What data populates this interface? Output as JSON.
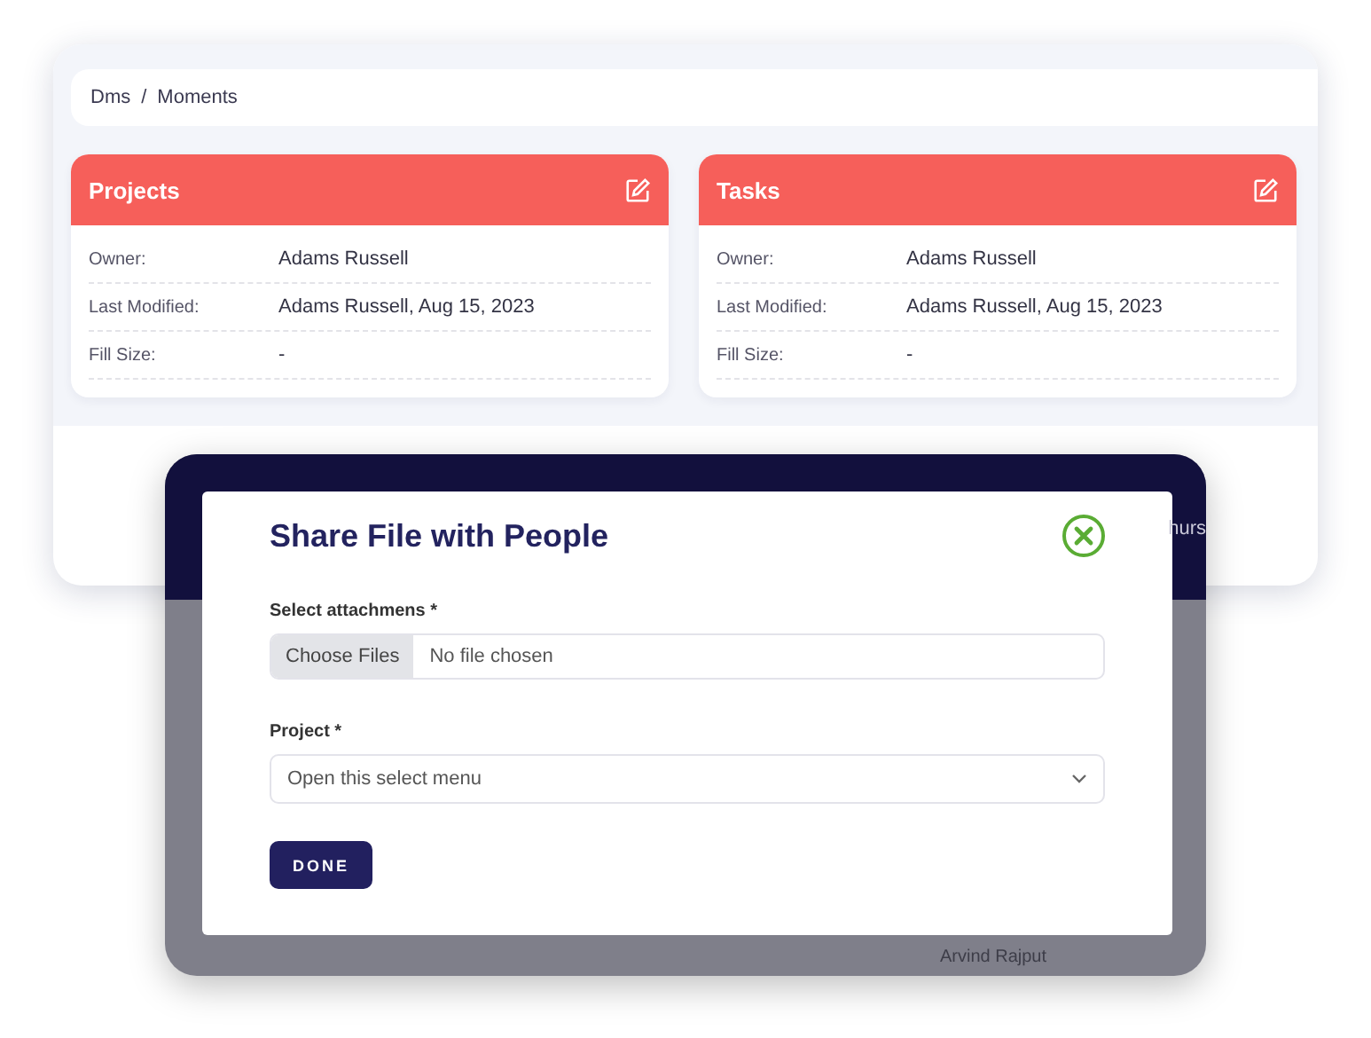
{
  "breadcrumb": [
    "Dms",
    "Moments"
  ],
  "breadcrumb_separator": "/",
  "cards": [
    {
      "title": "Projects",
      "rows": [
        {
          "label": "Owner:",
          "value": "Adams Russell"
        },
        {
          "label": "Last Modified:",
          "value": "Adams Russell, Aug 15, 2023"
        },
        {
          "label": "Fill Size:",
          "value": "-"
        }
      ]
    },
    {
      "title": "Tasks",
      "rows": [
        {
          "label": "Owner:",
          "value": "Adams Russell"
        },
        {
          "label": "Last Modified:",
          "value": "Adams Russell, Aug 15, 2023"
        },
        {
          "label": "Fill Size:",
          "value": "-"
        }
      ]
    }
  ],
  "background_texts": {
    "header_fragment": "hurs",
    "row_fragment": "Arvind Rajput"
  },
  "modal": {
    "title": "Share File with People",
    "attachments_label": "Select attachmens *",
    "file_button": "Choose Files",
    "file_status": "No file chosen",
    "project_label": "Project *",
    "project_placeholder": "Open this select menu",
    "done_button": "DONE"
  }
}
